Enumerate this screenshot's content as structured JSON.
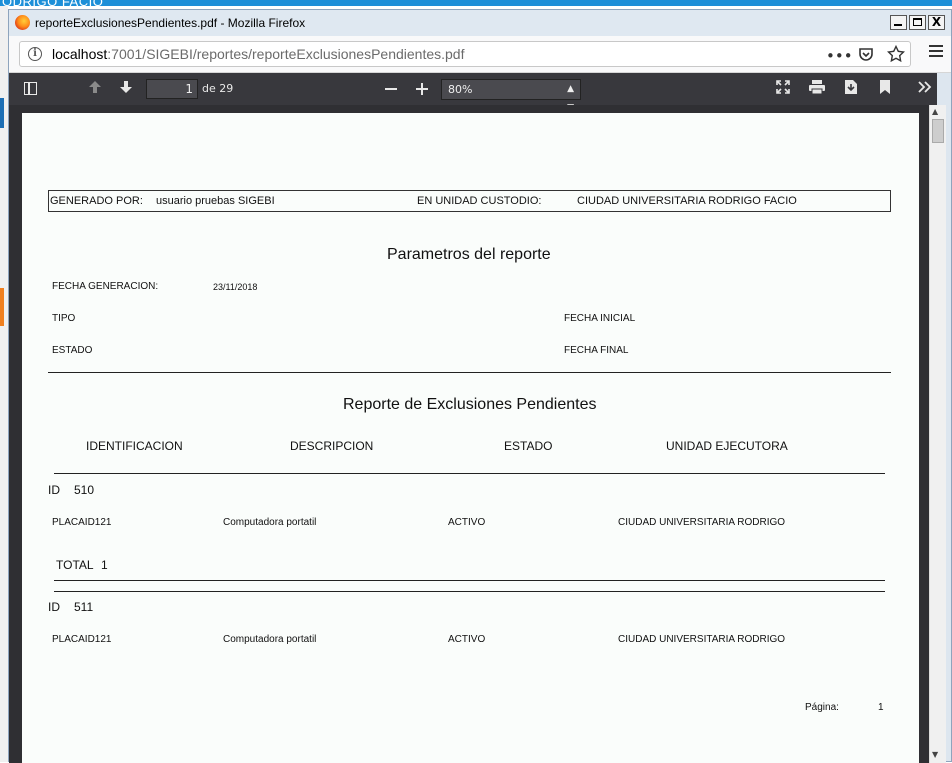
{
  "background": {
    "top_text": "ODRIGO FACIO"
  },
  "window": {
    "title": "reporteExclusionesPendientes.pdf - Mozilla Firefox",
    "close_label": "X"
  },
  "navbar": {
    "url_host": "localhost",
    "url_path": ":7001/SIGEBI/reportes/reporteExclusionesPendientes.pdf",
    "info_icon": "i",
    "more_label": "•••"
  },
  "pdf_toolbar": {
    "page_number": "1",
    "page_count": "de 29",
    "zoom": "80%"
  },
  "report": {
    "generado_por_label": "GENERADO POR:",
    "generado_por_value": "usuario pruebas SIGEBI",
    "unidad_label": "EN UNIDAD CUSTODIO:",
    "unidad_value": "CIUDAD UNIVERSITARIA RODRIGO FACIO",
    "params_title": "Parametros del reporte",
    "fecha_generacion_label": "FECHA GENERACION:",
    "fecha_generacion_value": "23/11/2018",
    "tipo_label": "TIPO",
    "fecha_inicial_label": "FECHA INICIAL",
    "estado_label": "ESTADO",
    "fecha_final_label": "FECHA FINAL",
    "report_title": "Reporte de Exclusiones Pendientes",
    "columns": [
      "IDENTIFICACION",
      "DESCRIPCION",
      "ESTADO",
      "UNIDAD EJECUTORA"
    ],
    "groups": [
      {
        "id_label": "ID",
        "id_value": "510",
        "row": [
          "PLACAID121",
          "Computadora portatil",
          "ACTIVO",
          "CIUDAD UNIVERSITARIA RODRIGO"
        ],
        "total_label": "TOTAL",
        "total_value": "1"
      },
      {
        "id_label": "ID",
        "id_value": "511",
        "row": [
          "PLACAID121",
          "Computadora portatil",
          "ACTIVO",
          "CIUDAD UNIVERSITARIA RODRIGO"
        ]
      }
    ],
    "pagina_label": "Página:",
    "pagina_value": "1"
  }
}
